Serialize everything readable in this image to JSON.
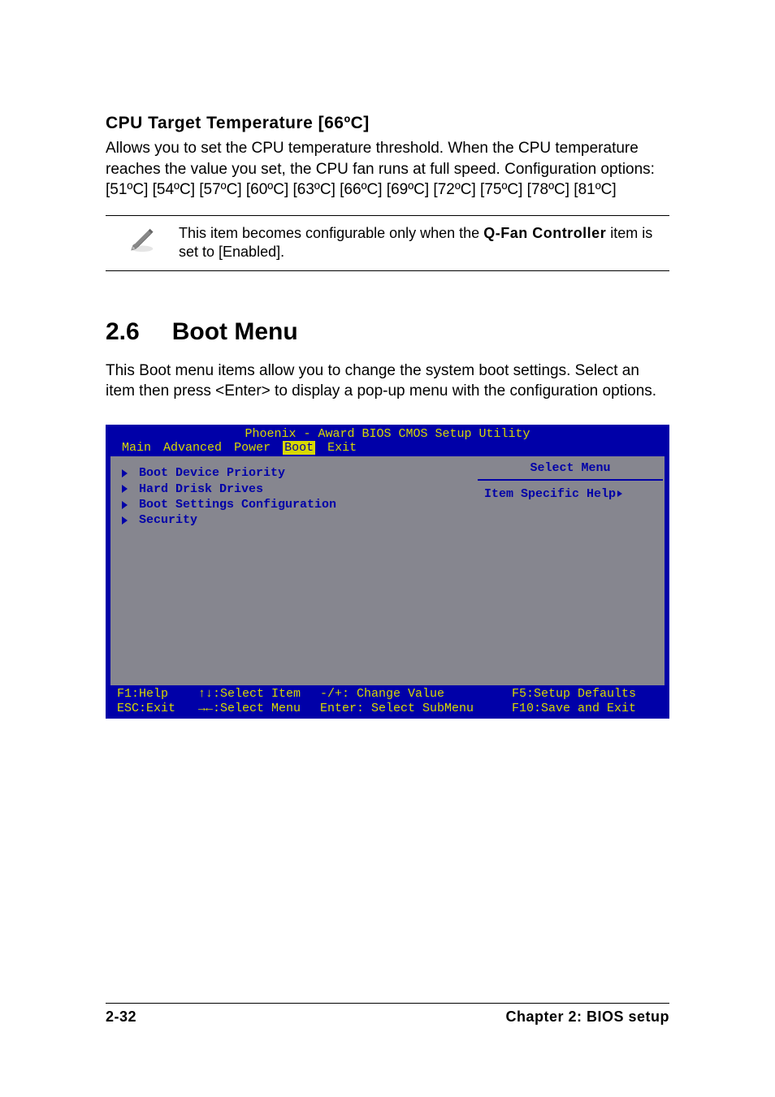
{
  "cpu_temp": {
    "heading": "CPU Target Temperature [66ºC]",
    "p1": "Allows you to set the CPU temperature threshold. When the CPU temperature reaches the value you set, the CPU fan runs at full speed. Configuration options: [51ºC] [54ºC] [57ºC] [60ºC] [63ºC] [66ºC] [69ºC] [72ºC] [75ºC] [78ºC] [81ºC]"
  },
  "note": {
    "prefix": "This item becomes configurable only when the ",
    "bold": "Q-Fan Controller",
    "suffix": " item is set to [Enabled]."
  },
  "section": {
    "num": "2.6",
    "title": "Boot Menu",
    "intro": "This Boot menu items allow you to change the system boot settings. Select an item then press <Enter> to display a pop-up menu with the configuration options."
  },
  "bios": {
    "title": "Phoenix - Award BIOS CMOS Setup Utility",
    "tabs": [
      "Main",
      "Advanced",
      "Power",
      "Boot",
      "Exit"
    ],
    "selected_tab_index": 3,
    "items": [
      "Boot Device Priority",
      "Hard Drisk Drives",
      "Boot Settings Configuration",
      "Security"
    ],
    "right_title": "Select Menu",
    "right_body": "Item Specific Help",
    "footer": {
      "c1a": "F1:Help",
      "c1b": "ESC:Exit",
      "c2a": "↑↓:Select Item",
      "c2b": "→←:Select Menu",
      "c3a": "-/+: Change Value",
      "c3b": "Enter: Select SubMenu",
      "c4a": "F5:Setup Defaults",
      "c4b": "F10:Save and Exit"
    }
  },
  "footer": {
    "left": "2-32",
    "right": "Chapter 2: BIOS setup"
  }
}
